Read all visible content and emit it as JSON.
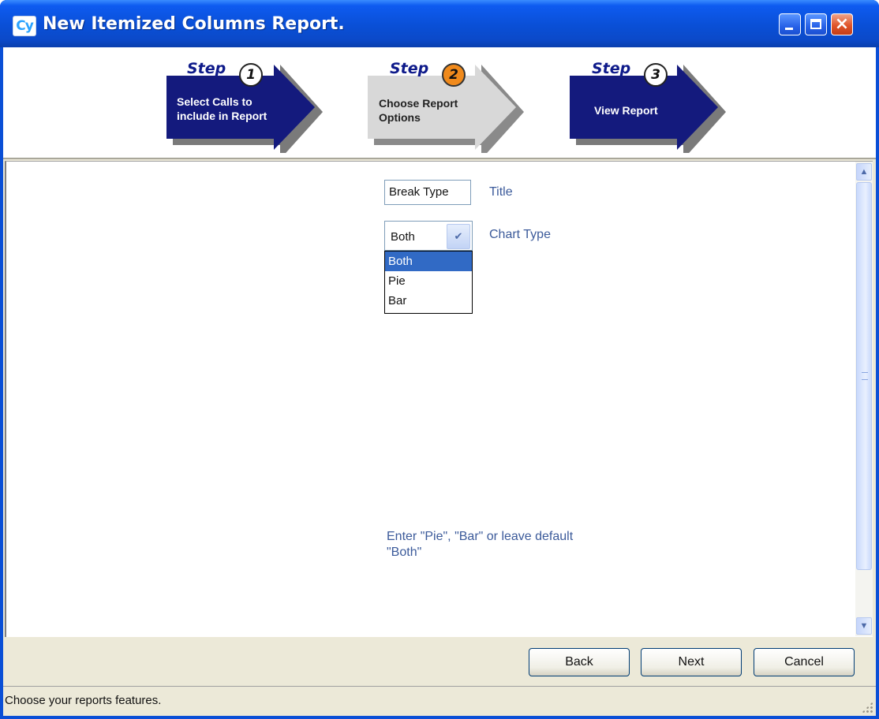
{
  "window": {
    "title": "New Itemized Columns Report.",
    "icon_text": "Cy"
  },
  "steps": [
    {
      "word": "Step",
      "number": "1",
      "label_line1": "Select Calls to",
      "label_line2": "include in Report",
      "state": "done"
    },
    {
      "word": "Step",
      "number": "2",
      "label_line1": "Choose Report",
      "label_line2": "Options",
      "state": "active"
    },
    {
      "word": "Step",
      "number": "3",
      "label_line1": "View Report",
      "label_line2": "",
      "state": "pending"
    }
  ],
  "form": {
    "title_value": "Break Type",
    "title_label": "Title",
    "chart_type_value": "Both",
    "chart_type_label": "Chart Type",
    "chart_type_options": [
      "Both",
      "Pie",
      "Bar"
    ],
    "selected_option": "Both",
    "hint": "Enter \"Pie\", \"Bar\" or leave default \"Both\""
  },
  "buttons": {
    "back": "Back",
    "next": "Next",
    "cancel": "Cancel"
  },
  "status": {
    "text": "Choose your reports features."
  },
  "colors": {
    "titlebar": "#0a4fd6",
    "step_active_arrow": "#d9d9d9",
    "step_inactive_arrow": "#1a1a80",
    "step_active_badge": "#f08a1c",
    "label_text": "#3b5a9a",
    "selected_option_bg": "#316ac5"
  },
  "icons": {
    "minimize": "minimize-icon",
    "maximize": "maximize-icon",
    "close": "close-icon",
    "dropdown": "chevron-down-icon",
    "scroll_up": "arrow-up-icon",
    "scroll_down": "arrow-down-icon"
  }
}
